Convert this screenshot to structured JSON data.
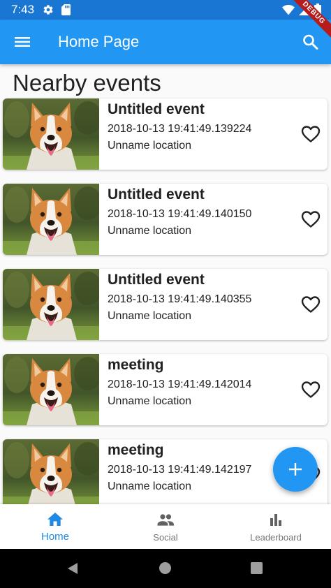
{
  "status_bar": {
    "time": "7:43",
    "icons": [
      "gear-icon",
      "sd-card-icon",
      "wifi-icon",
      "signal-icon",
      "battery-icon"
    ],
    "debug_label": "DEBUG",
    "color": "#1976d2"
  },
  "app_bar": {
    "title": "Home Page",
    "menu_icon": "menu-icon",
    "search_icon": "search-icon",
    "color": "#2196f3"
  },
  "section_title": "Nearby events",
  "events": [
    {
      "name": "Untitled event",
      "datetime": "2018-10-13 19:41:49.139224",
      "location": "Unname location",
      "favorite_icon": "heart-outline-icon"
    },
    {
      "name": "Untitled event",
      "datetime": "2018-10-13 19:41:49.140150",
      "location": "Unname location",
      "favorite_icon": "heart-outline-icon"
    },
    {
      "name": "Untitled event",
      "datetime": "2018-10-13 19:41:49.140355",
      "location": "Unname location",
      "favorite_icon": "heart-outline-icon"
    },
    {
      "name": "meeting",
      "datetime": "2018-10-13 19:41:49.142014",
      "location": "Unname location",
      "favorite_icon": "heart-outline-icon"
    },
    {
      "name": "meeting",
      "datetime": "2018-10-13 19:41:49.142197",
      "location": "Unname location",
      "favorite_icon": "heart-outline-icon"
    }
  ],
  "fab": {
    "icon": "plus-icon",
    "color": "#2196f3"
  },
  "bottom_nav": {
    "items": [
      {
        "label": "Home",
        "icon": "home-icon",
        "active": true
      },
      {
        "label": "Social",
        "icon": "people-icon",
        "active": false
      },
      {
        "label": "Leaderboard",
        "icon": "bar-chart-icon",
        "active": false
      }
    ],
    "active_color": "#1e88e5"
  },
  "system_nav": {
    "icons": [
      "back-icon",
      "home-circle-icon",
      "recent-apps-icon"
    ]
  }
}
